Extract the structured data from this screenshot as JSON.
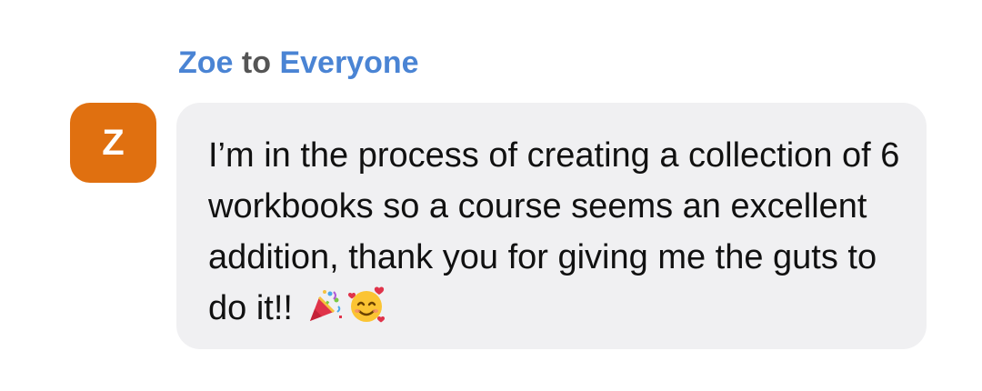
{
  "message": {
    "sender": "Zoe",
    "connector": "to",
    "recipient": "Everyone",
    "avatar_letter": "Z",
    "avatar_color": "#e07010",
    "text": "I’m in the process of creating a collection of 6 workbooks so a course seems an excellent addition, thank you for giving me the guts to do it!! ",
    "emojis": [
      "party-popper-emoji",
      "smiling-face-with-hearts-emoji"
    ]
  },
  "colors": {
    "name": "#4a84d4",
    "bubble": "#f0f0f2"
  }
}
